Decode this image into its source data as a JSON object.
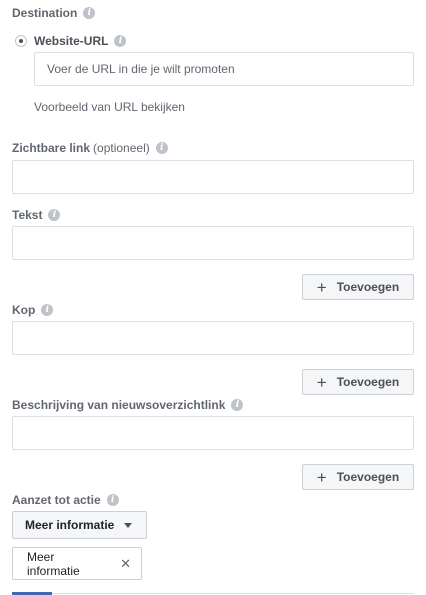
{
  "destination": {
    "label": "Destination",
    "option_label": "Website-URL",
    "url_placeholder": "Voer de URL in die je wilt promoten",
    "preview_link": "Voorbeeld van URL bekijken"
  },
  "display_link": {
    "label": "Zichtbare link",
    "optional": "(optioneel)"
  },
  "text": {
    "label": "Tekst",
    "add_label": "Toevoegen"
  },
  "headline": {
    "label": "Kop",
    "add_label": "Toevoegen"
  },
  "news_feed_description": {
    "label": "Beschrijving van nieuwsoverzichtlink",
    "add_label": "Toevoegen"
  },
  "call_to_action": {
    "label": "Aanzet tot actie",
    "dropdown_value": "Meer informatie",
    "selected_token": "Meer informatie"
  },
  "icons": {
    "info": "info-icon",
    "add": "plus-icon",
    "dropdown": "caret-down-icon",
    "remove": "close-icon"
  },
  "colors": {
    "accent": "#4267b2",
    "label": "#606770",
    "border": "#dddfe2",
    "button_bg": "#f5f6f7"
  }
}
